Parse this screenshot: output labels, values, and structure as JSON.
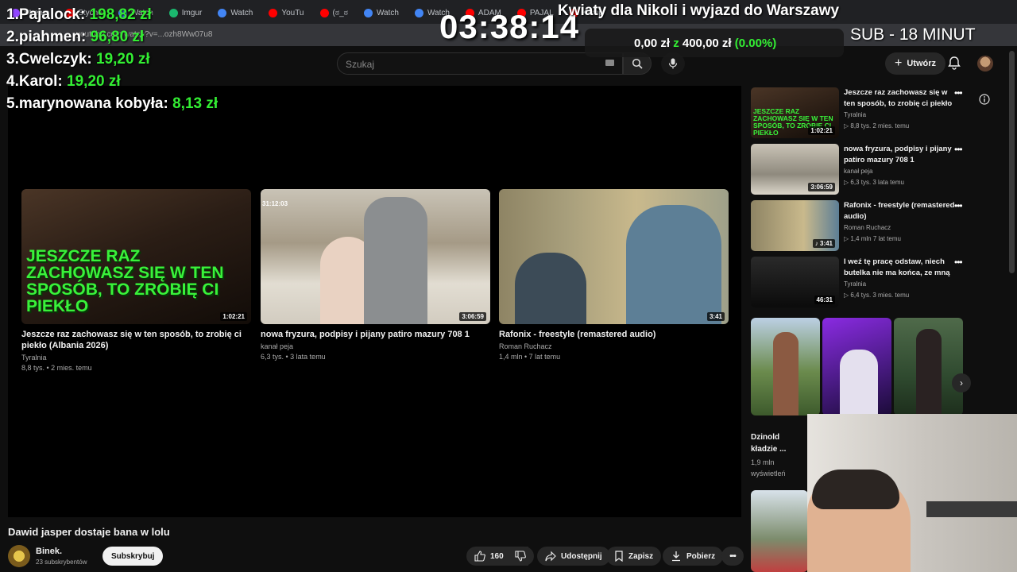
{
  "browser": {
    "tabs": [
      {
        "label": "Stream",
        "color": "#9146ff"
      },
      {
        "label": "Stycho",
        "color": "#ff0000"
      },
      {
        "label": "Watch",
        "color": "#4285f4"
      },
      {
        "label": "Imgur",
        "color": "#1bb76e"
      },
      {
        "label": "Watch",
        "color": "#4285f4"
      },
      {
        "label": "YouTu",
        "color": "#ff0000"
      },
      {
        "label": "(ಠ_ಠ",
        "color": "#ff0000"
      },
      {
        "label": "Watch",
        "color": "#4285f4"
      },
      {
        "label": "Watch",
        "color": "#4285f4"
      },
      {
        "label": "ADAM",
        "color": "#ff0000"
      },
      {
        "label": "PAJAL",
        "color": "#ff0000"
      },
      {
        "label": "Komp",
        "color": "#ff0000"
      }
    ],
    "url": "youtube.com/watch?v=...ozh8Ww07u8"
  },
  "youtube": {
    "search_placeholder": "Szukaj",
    "create_label": "Utwórz"
  },
  "overlay": {
    "leaderboard": [
      {
        "rank": "1.",
        "name": "Pajalock:",
        "amount": "198,82 zł"
      },
      {
        "rank": "2.",
        "name": "piahmen:",
        "amount": "96,80 zł"
      },
      {
        "rank": "3.",
        "name": "Cwelczyk:",
        "amount": "19,20 zł"
      },
      {
        "rank": "4.",
        "name": "Karol:",
        "amount": "19,20 zł"
      },
      {
        "rank": "5.",
        "name": "marynowana kobyła:",
        "amount": "8,13 zł"
      }
    ],
    "timer": "03:38:14",
    "top_line": "Kwiaty dla Nikoli i wyjazd do Warszawy",
    "sub_line": "SUB - 18 MINUT",
    "goal": {
      "current": "0,00 zł",
      "word": "z",
      "target": "400,00 zł",
      "percent": "(0.00%)"
    },
    "colors": {
      "amount": "#33ee33"
    }
  },
  "endscreen": [
    {
      "title": "Jeszcze raz zachowasz się w ten sposób, to zrobię ci piekło (Albania 2026)",
      "channel": "Tyralnia",
      "meta": "8,8 tys. • 2 mies. temu",
      "duration": "1:02:21",
      "overlay_text": "JESZCZE RAZ ZACHOWASZ SIĘ W TEN SPOSÓB, TO ZROBIĘ CI PIEKŁO"
    },
    {
      "title": "nowa fryzura, podpisy i pijany patiro mazury 708 1",
      "channel": "kanał peja",
      "meta": "6,3 tys. • 3 lata temu",
      "duration": "3:06:59",
      "timestamp": "31:12:03"
    },
    {
      "title": "Rafonix - freestyle (remastered audio)",
      "channel": "Roman Ruchacz",
      "meta": "1,4 mln • 7 lat temu",
      "duration": "3:41"
    }
  ],
  "video": {
    "title": "Dawid jasper dostaje bana w lolu",
    "channel": "Binek.",
    "subscribers": "23 subskrybentów",
    "subscribe_label": "Subskrybuj",
    "likes": "160",
    "share_label": "Udostępnij",
    "save_label": "Zapisz",
    "download_label": "Pobierz"
  },
  "recommendations": [
    {
      "title": "Jeszcze raz zachowasz się w ten sposób, to zrobię ci piekło ...",
      "channel": "Tyralnia",
      "meta": "▷ 8,8 tys.   2 mies. temu",
      "duration": "1:02:21"
    },
    {
      "title": "nowa fryzura, podpisy i pijany patiro mazury 708 1",
      "channel": "kanał peja",
      "meta": "▷ 6,3 tys.   3 lata temu",
      "duration": "3:06:59"
    },
    {
      "title": "Rafonix - freestyle (remastered audio)",
      "channel": "Roman Ruchacz",
      "meta": "▷ 1,4 mln   7 lat temu",
      "duration": "♪ 3:41"
    },
    {
      "title": "I weź tę pracę odstaw, niech butelka nie ma końca, ze mną ...",
      "channel": "Tyralnia",
      "meta": "▷ 6,4 tys.   3 mies. temu",
      "duration": "46:31"
    }
  ],
  "shorts": {
    "title": "Dzinold kładzie ...",
    "views": "1,9 mln wyświetleń"
  }
}
